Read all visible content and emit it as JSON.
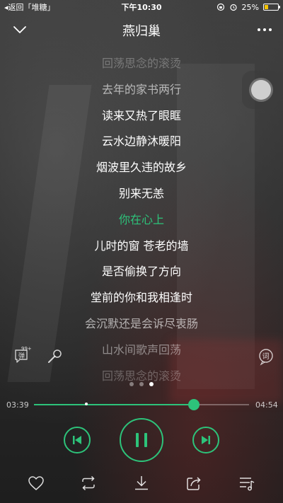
{
  "status_bar": {
    "back_label": "◂返回「堆糖」",
    "time": "下午10:30",
    "battery": "25%",
    "battery_level": 0.25
  },
  "header": {
    "title": "燕归巢"
  },
  "lyrics": [
    {
      "text": "回荡思念的滚烫",
      "state": "fade"
    },
    {
      "text": "去年的家书两行",
      "state": "dim"
    },
    {
      "text": "读来又热了眼眶",
      "state": "normal"
    },
    {
      "text": "云水边静沐暖阳",
      "state": "normal"
    },
    {
      "text": "烟波里久违的故乡",
      "state": "normal"
    },
    {
      "text": "别来无恙",
      "state": "normal"
    },
    {
      "text": "你在心上",
      "state": "active"
    },
    {
      "text": "儿时的窗 苍老的墙",
      "state": "normal"
    },
    {
      "text": "是否偷换了方向",
      "state": "normal"
    },
    {
      "text": "堂前的你和我相逢时",
      "state": "normal"
    },
    {
      "text": "会沉默还是会诉尽衷肠",
      "state": "dim"
    },
    {
      "text": "山水间歌声回荡",
      "state": "dim2"
    },
    {
      "text": "回荡思念的滚烫",
      "state": "fade"
    }
  ],
  "tools": {
    "danmaku_icon": "danmaku-icon",
    "danmaku_count": "99+",
    "danmaku_label": "弹",
    "mic_icon": "microphone-icon",
    "lyric_label": "词"
  },
  "page_dots": {
    "count": 3,
    "active": 2
  },
  "progress": {
    "current": "03:39",
    "total": "04:54",
    "fraction": 0.744
  },
  "controls": {
    "prev_icon": "previous-icon",
    "pause_icon": "pause-icon",
    "next_icon": "next-icon"
  },
  "bottom_bar": {
    "items": [
      "heart-icon",
      "repeat-icon",
      "download-icon",
      "share-icon",
      "playlist-icon"
    ]
  },
  "colors": {
    "accent": "#2dc37a"
  }
}
